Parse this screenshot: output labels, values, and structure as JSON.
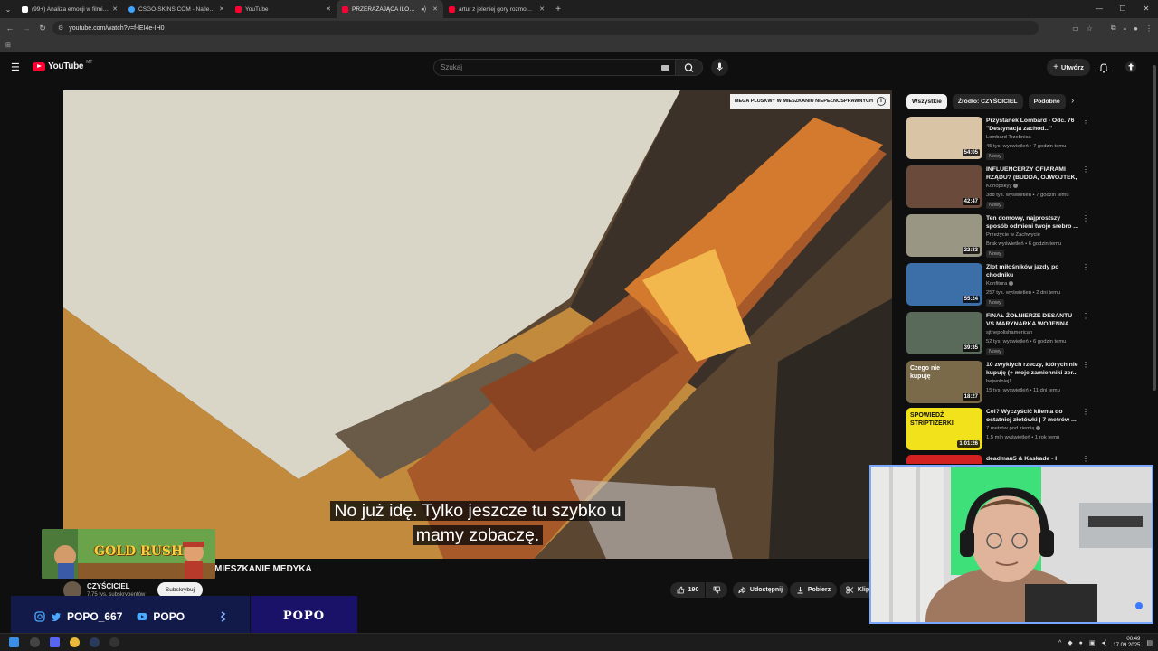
{
  "browser": {
    "tabs": [
      {
        "title": "(99+) Analiza emocji w filmie - ...",
        "favicon_color": "#ffffff"
      },
      {
        "title": "CSGO-SKINS.COM - Najlepsze ...",
        "favicon_color": "#3ea6ff"
      },
      {
        "title": "YouTube",
        "favicon_color": "#ff0033"
      },
      {
        "title": "PRZERAŻAJĄCA ILOŚĆ PLU...",
        "favicon_color": "#ff0033",
        "active": true
      },
      {
        "title": "artur z jeleniej gory rozmowa z ...",
        "favicon_color": "#ff0033"
      }
    ],
    "url": "youtube.com/watch?v=f-lEI4e-IH0"
  },
  "youtube": {
    "logo_text": "YouTube",
    "logo_region": "MT",
    "search_placeholder": "Szukaj",
    "create_label": "Utwórz"
  },
  "video": {
    "overlay_label": "MEGA PLUSKWY W MIESZKANIU NIEPEŁNOSPRAWNYCH",
    "subtitle_line1": "No już idę. Tylko jeszcze tu szybko u",
    "subtitle_line2": "mamy zobaczę.",
    "title": "MIESZKANIE MEDYKA",
    "channel": "CZYŚCICIEL",
    "subscribers": "7,75 tys. subskrybentów",
    "subscribe_label": "Subskrybuj",
    "likes": "190",
    "share_label": "Udostępnij",
    "download_label": "Pobierz",
    "clip_label": "Klip"
  },
  "sidebar": {
    "chips": [
      "Wszystkie",
      "Źródło: CZYŚCICIEL",
      "Podobne"
    ],
    "items": [
      {
        "title": "Przystanek Lombard - Odc. 76 \"Destynacja zachód...\"",
        "channel": "Lombard Trzebnica",
        "meta": "45 tys. wyświetleń • 7 godzin temu",
        "badge": "Nowy",
        "duration": "54:05",
        "thumb_color": "#d9c4a6"
      },
      {
        "title": "INFLUENCERZY OFIARAMI RZĄDU? (BUDDA, OJWOJTEK, ...",
        "channel": "Konopskyy",
        "meta": "388 tys. wyświetleń • 7 godzin temu",
        "badge": "Nowy",
        "duration": "42:47",
        "thumb_color": "#6a4a3a"
      },
      {
        "title": "Ten domowy, najprostszy sposób odmieni twoje srebro ...",
        "channel": "Przeżycie w Zachwycie",
        "meta": "Brak wyświetleń • 6 godzin temu",
        "badge": "Nowy",
        "duration": "22:33",
        "thumb_color": "#9a9684"
      },
      {
        "title": "Zlot miłośników jazdy po chodniku",
        "channel": "Konfitura",
        "meta": "257 tys. wyświetleń • 2 dni temu",
        "badge": "Nowy",
        "duration": "55:24",
        "thumb_color": "#3c6fa8"
      },
      {
        "title": "FINAŁ ŻOŁNIERZE DESANTU VS MARYNARKA WOJENNA (2/2)...",
        "channel": "sjthepolishamerican",
        "meta": "52 tys. wyświetleń • 6 godzin temu",
        "badge": "Nowy",
        "duration": "39:35",
        "thumb_color": "#5a6a5a"
      },
      {
        "title": "10 zwykłych rzeczy, których nie kupuję (+ moje zamienniki zer...",
        "channel": "hejwolniej!",
        "meta": "15 tys. wyświetleń • 11 dni temu",
        "badge": "",
        "duration": "18:27",
        "thumb_color": "#7a6a4a",
        "thumb_text": "Czego nie kupuję"
      },
      {
        "title": "Cel? Wyczyścić klienta do ostatniej złotówki | 7 metrów ...",
        "channel": "7 metrów pod ziemią",
        "meta": "1,5 mln wyświetleń • 1 rok temu",
        "badge": "",
        "duration": "1:01:26",
        "thumb_color": "#f2e21c",
        "thumb_text": "SPOWIEDŹ STRIPTIZERKI"
      },
      {
        "title": "deadmau5 & Kaskade - I",
        "channel": "",
        "meta": "",
        "badge": "",
        "duration": "",
        "thumb_color": "#d32020"
      }
    ]
  },
  "overlay": {
    "game_title": "GOLD RUSH",
    "handle1": "POPO_667",
    "handle2": "POPO",
    "brand": "POPO"
  },
  "taskbar": {
    "time": "00:49",
    "date": "17.09.2025"
  }
}
